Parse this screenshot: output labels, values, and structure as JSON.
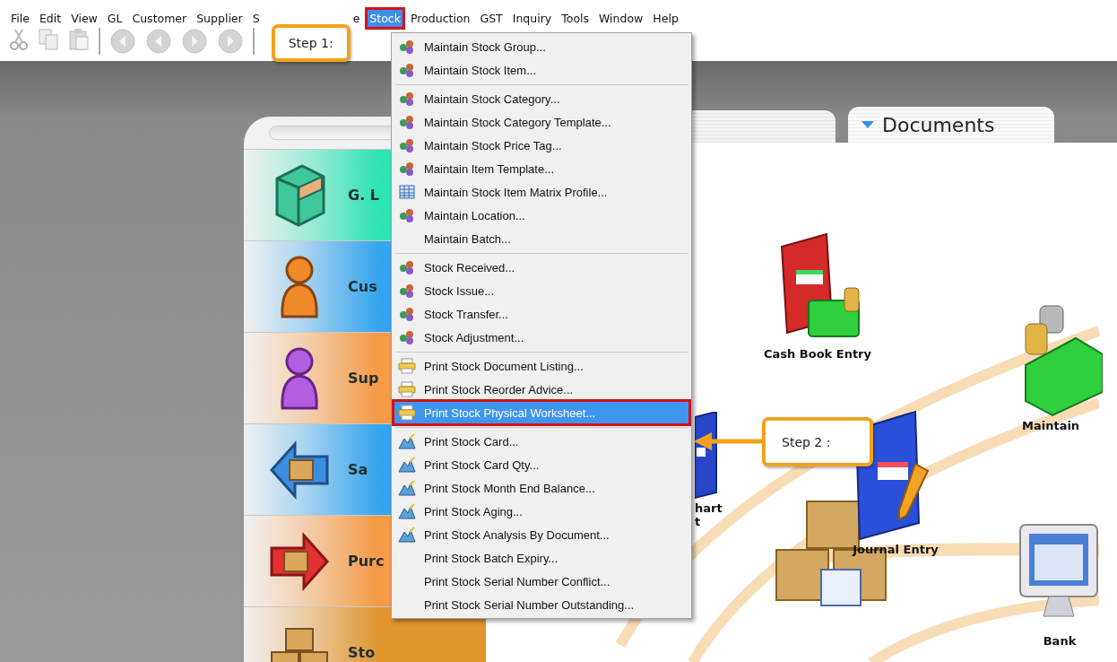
{
  "menubar": [
    {
      "label": "File",
      "selected": false
    },
    {
      "label": "Edit",
      "selected": false
    },
    {
      "label": "View",
      "selected": false
    },
    {
      "label": "GL",
      "selected": false
    },
    {
      "label": "Customer",
      "selected": false
    },
    {
      "label": "Supplier",
      "selected": false
    },
    {
      "label": "S",
      "selected": false
    },
    {
      "label": "e",
      "selected": false
    },
    {
      "label": "Stock",
      "selected": true
    },
    {
      "label": "Production",
      "selected": false
    },
    {
      "label": "GST",
      "selected": false
    },
    {
      "label": "Inquiry",
      "selected": false
    },
    {
      "label": "Tools",
      "selected": false
    },
    {
      "label": "Window",
      "selected": false
    },
    {
      "label": "Help",
      "selected": false
    }
  ],
  "callouts": [
    {
      "text": "Step 1:"
    },
    {
      "text": "Step 2 :"
    }
  ],
  "menu": {
    "sections": [
      [
        {
          "label": "Maintain Stock Group...",
          "kind": "icon",
          "selected": false
        },
        {
          "label": "Maintain Stock Item...",
          "kind": "icon",
          "selected": false
        }
      ],
      [
        {
          "label": "Maintain Stock Category...",
          "kind": "icon",
          "selected": false
        },
        {
          "label": "Maintain Stock Category Template...",
          "kind": "icon",
          "selected": false
        },
        {
          "label": "Maintain Stock Price Tag...",
          "kind": "icon",
          "selected": false
        },
        {
          "label": "Maintain Item Template...",
          "kind": "icon",
          "selected": false
        },
        {
          "label": "Maintain Stock Item Matrix Profile...",
          "kind": "grid",
          "selected": false
        },
        {
          "label": "Maintain Location...",
          "kind": "icon",
          "selected": false
        },
        {
          "label": "Maintain Batch...",
          "kind": "text",
          "selected": false
        }
      ],
      [
        {
          "label": "Stock Received...",
          "kind": "icon",
          "selected": false
        },
        {
          "label": "Stock Issue...",
          "kind": "icon",
          "selected": false
        },
        {
          "label": "Stock Transfer...",
          "kind": "icon",
          "selected": false
        },
        {
          "label": "Stock Adjustment...",
          "kind": "icon",
          "selected": false
        }
      ],
      [
        {
          "label": "Print Stock Document Listing...",
          "kind": "printer",
          "selected": false
        },
        {
          "label": "Print Stock Reorder Advice...",
          "kind": "printer",
          "selected": false
        },
        {
          "label": "Print Stock Physical Worksheet...",
          "kind": "printer",
          "selected": true
        }
      ],
      [
        {
          "label": "Print Stock Card...",
          "kind": "chart",
          "selected": false
        },
        {
          "label": "Print Stock Card Qty...",
          "kind": "chart",
          "selected": false
        },
        {
          "label": "Print Stock Month End Balance...",
          "kind": "chart",
          "selected": false
        },
        {
          "label": "Print Stock Aging...",
          "kind": "chart",
          "selected": false
        },
        {
          "label": "Print Stock Analysis By Document...",
          "kind": "chart",
          "selected": false
        },
        {
          "label": "Print Stock Batch Expiry...",
          "kind": "text",
          "selected": false
        },
        {
          "label": "Print Stock Serial Number Conflict...",
          "kind": "text",
          "selected": false
        },
        {
          "label": "Print Stock Serial Number Outstanding...",
          "kind": "text",
          "selected": false
        }
      ]
    ]
  },
  "modules": [
    {
      "label": "G. L",
      "color": "#2de3b4"
    },
    {
      "label": "Cus",
      "color": "#35a4ee"
    },
    {
      "label": "Sup",
      "color": "#f59a45"
    },
    {
      "label": "Sa",
      "color": "#35a4ee"
    },
    {
      "label": "Purc",
      "color": "#f59a45"
    },
    {
      "label": "Sto",
      "color": "#e0952e"
    }
  ],
  "tabs": [
    {
      "label": "Documents",
      "selected": true
    }
  ],
  "canvas_items": [
    {
      "lines": [
        "Cash Book Entry"
      ]
    },
    {
      "lines": [
        "Maintain"
      ]
    },
    {
      "lines": [
        "hart",
        "t"
      ]
    },
    {
      "lines": [
        "Journal Entry"
      ]
    },
    {
      "lines": [
        "Bank"
      ]
    }
  ]
}
